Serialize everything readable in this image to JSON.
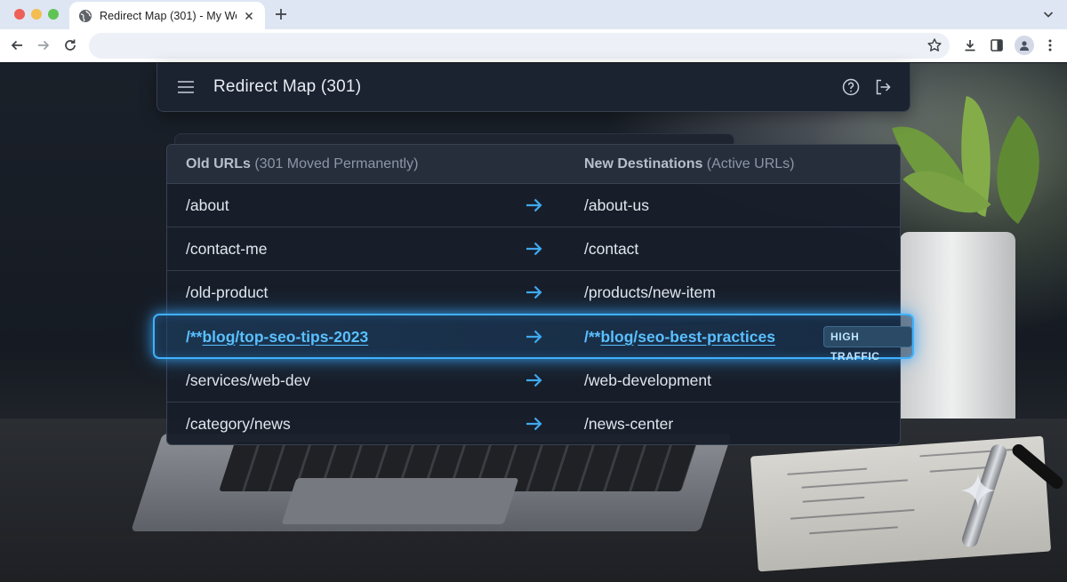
{
  "browser": {
    "tab_title": "Redirect Map (301) - My Website",
    "address_value": "",
    "icons": [
      "globe-icon",
      "close-icon",
      "plus-icon",
      "chevron-down-icon",
      "back-arrow-icon",
      "forward-arrow-icon",
      "reload-icon",
      "star-icon",
      "download-icon",
      "sidebar-icon",
      "profile-icon",
      "kebab-menu-icon"
    ]
  },
  "app": {
    "title": "Redirect Map (301)",
    "icons": [
      "hamburger-menu-icon",
      "help-icon",
      "logout-icon"
    ]
  },
  "table": {
    "header_old_bold": "Old URLs",
    "header_old_rest": " (301 Moved Permanently)",
    "header_new_bold": "New Destinations",
    "header_new_rest": " (Active URLs)",
    "rows": [
      {
        "old": "/about",
        "new": "/about-us"
      },
      {
        "old": "/contact-me",
        "new": "/contact"
      },
      {
        "old": "/old-product",
        "new": "/products/new-item"
      },
      {
        "old_prefix": "/**",
        "old_link1": "blog",
        "old_sep": "/",
        "old_link2": "top-seo-tips-2023",
        "new_prefix": "/**",
        "new_link1": "blog",
        "new_sep": "/",
        "new_link2": "seo-best-practices",
        "badge": "HIGH TRAFFIC"
      },
      {
        "old": "/services/web-dev",
        "new": "/web-development"
      },
      {
        "old": "/category/news",
        "new": "/news-center"
      }
    ]
  },
  "colors": {
    "accent": "#3fb2ff",
    "highlight_text": "#59c0ff",
    "panel": "#1b2230"
  }
}
